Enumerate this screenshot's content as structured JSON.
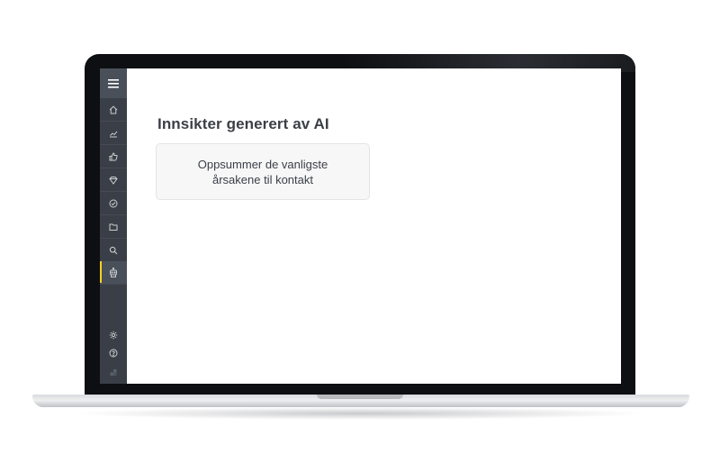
{
  "sidebar": {
    "items": [
      {
        "icon": "home-icon"
      },
      {
        "icon": "chart-icon"
      },
      {
        "icon": "thumbs-up-icon"
      },
      {
        "icon": "diamond-icon"
      },
      {
        "icon": "check-circle-icon"
      },
      {
        "icon": "folder-icon"
      },
      {
        "icon": "search-icon"
      },
      {
        "icon": "robot-icon",
        "active": true
      }
    ],
    "bottom": [
      {
        "icon": "gear-icon"
      },
      {
        "icon": "help-icon"
      },
      {
        "icon": "logo-icon"
      }
    ],
    "active_color": "#f2d21b"
  },
  "main": {
    "title": "Innsikter generert av AI",
    "suggestion": "Oppsummer de vanligste årsakene til kontakt"
  }
}
